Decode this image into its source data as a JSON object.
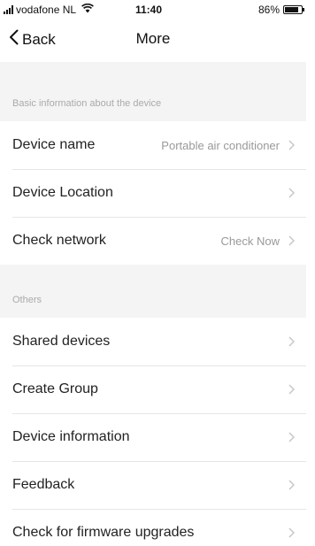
{
  "status_bar": {
    "carrier": "vodafone NL",
    "time": "11:40",
    "battery": "86%",
    "battery_level": 0.86
  },
  "nav": {
    "back_label": "Back",
    "title": "More"
  },
  "sections": {
    "basic": {
      "header": "Basic information about the device",
      "rows": [
        {
          "label": "Device name",
          "value": "Portable air conditioner"
        },
        {
          "label": "Device Location",
          "value": ""
        },
        {
          "label": "Check network",
          "value": "Check Now"
        }
      ]
    },
    "others": {
      "header": "Others",
      "rows": [
        {
          "label": "Shared devices"
        },
        {
          "label": "Create Group"
        },
        {
          "label": "Device information"
        },
        {
          "label": "Feedback"
        },
        {
          "label": "Check for firmware upgrades"
        }
      ]
    }
  },
  "icons": {
    "back": "chevron-left-icon",
    "row_arrow": "chevron-right-icon",
    "signal": "signal-bars-icon",
    "wifi": "wifi-icon",
    "battery": "battery-icon"
  }
}
